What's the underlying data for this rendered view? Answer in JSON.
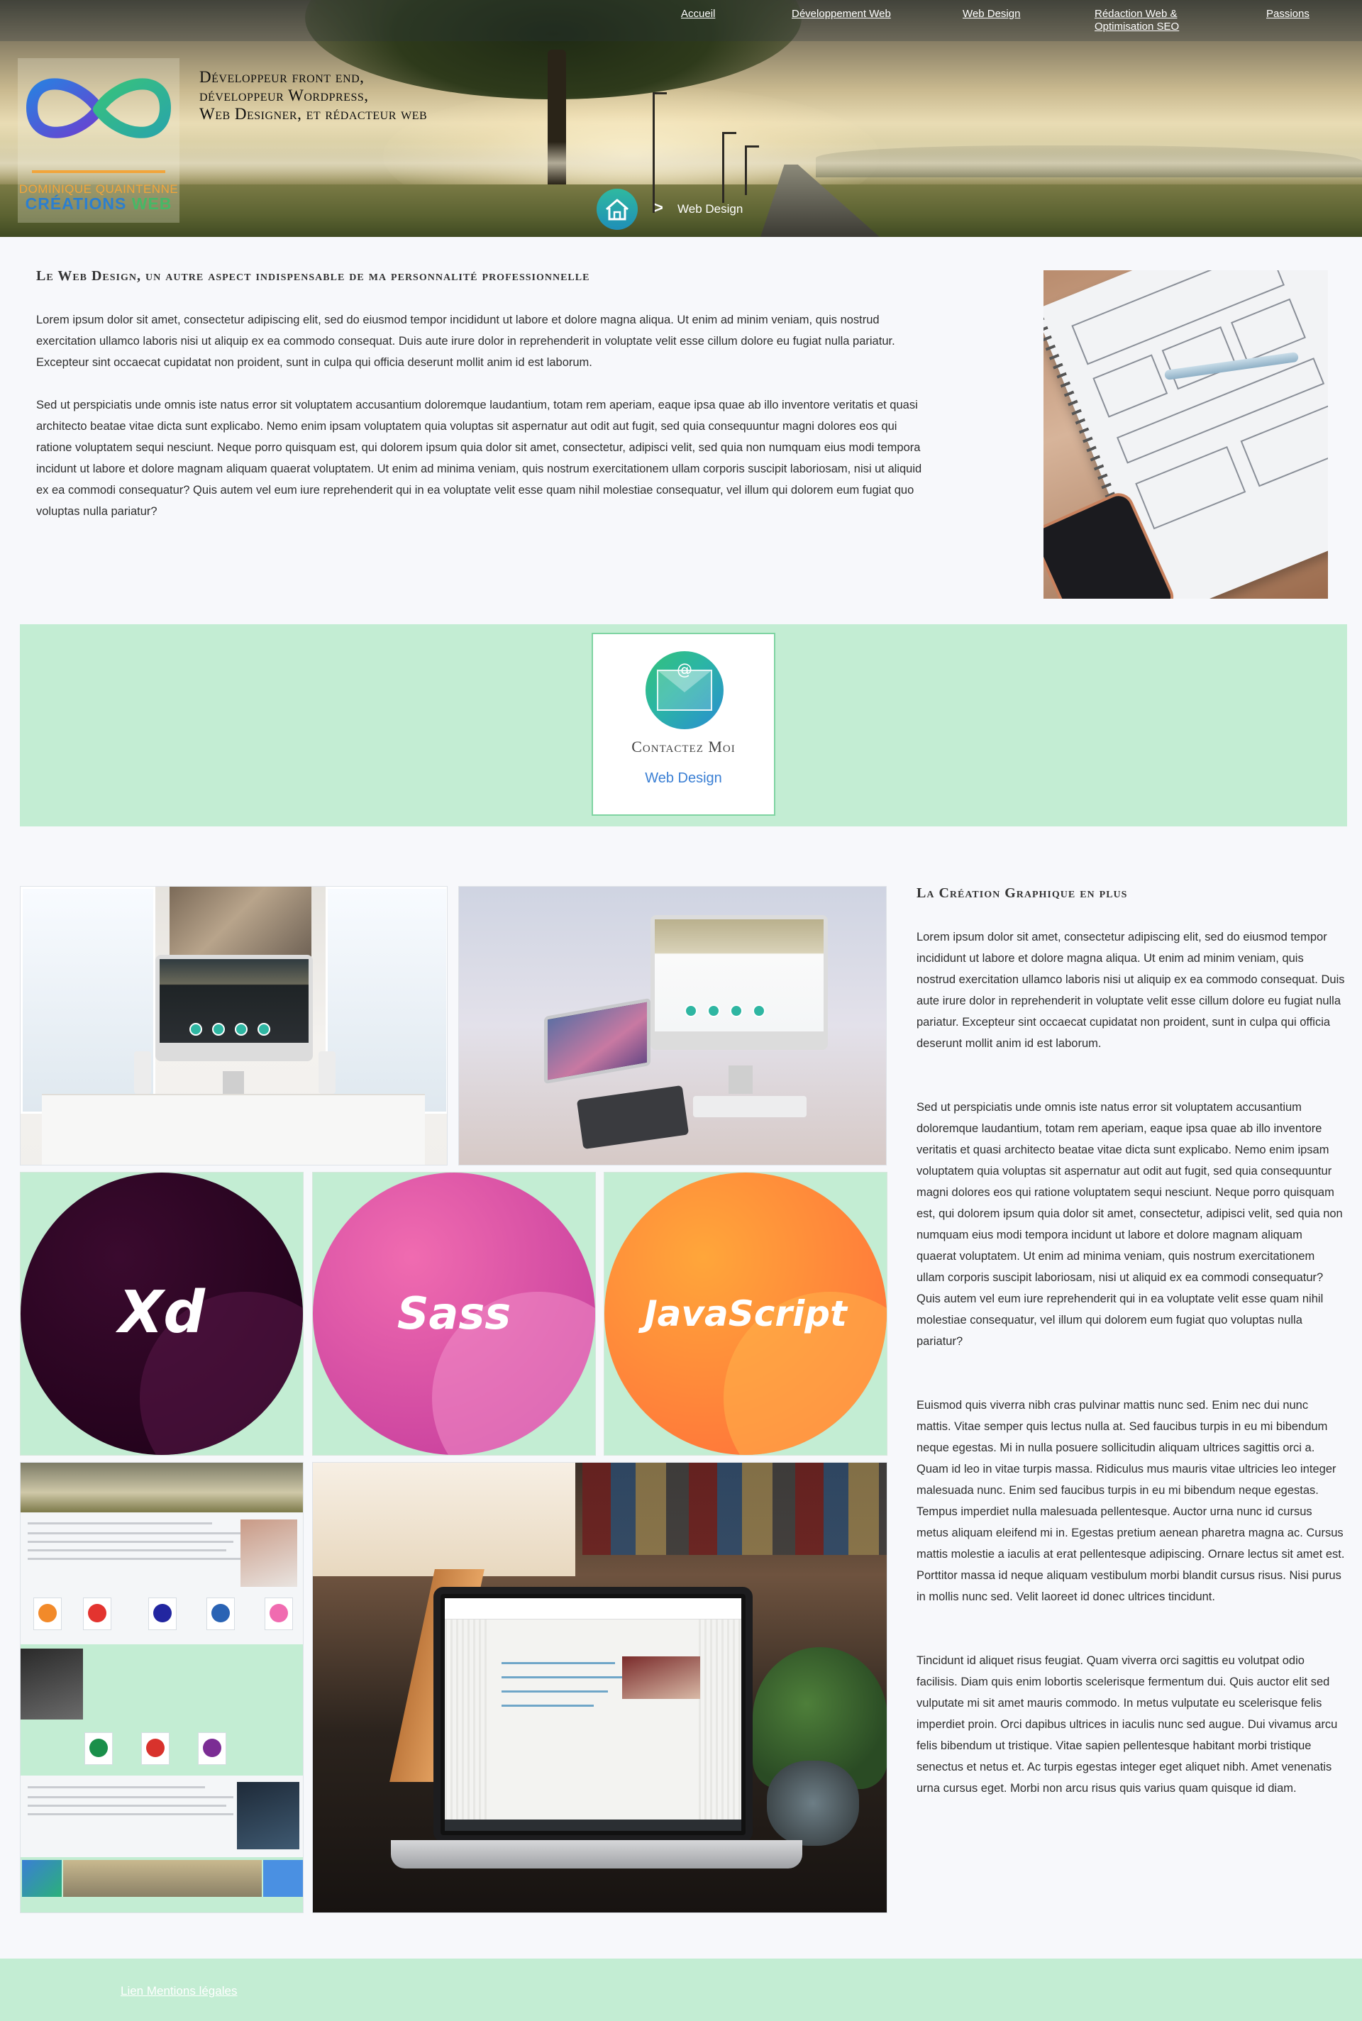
{
  "nav": {
    "items": [
      {
        "label": "Accueil"
      },
      {
        "label": "Développement Web"
      },
      {
        "label": "Web Design"
      },
      {
        "label": "Rédaction Web  &",
        "label2": "Optimisation SEO"
      },
      {
        "label": "Passions"
      }
    ]
  },
  "logo": {
    "name": "DOMINIQUE QUAINTENNE",
    "brand_part1": "CRÉATIONS ",
    "brand_part2": "WEB"
  },
  "tagline": {
    "lines": [
      "Développeur front end,",
      "développeur Wordpress,",
      "Web Designer, et rédacteur web"
    ]
  },
  "breadcrumb": {
    "home_icon": "home-icon",
    "separator": ">",
    "current": "Web Design"
  },
  "intro": {
    "title": "Le Web Design, un autre aspect indispensable de ma personnalité professionnelle",
    "paragraphs": [
      "Lorem ipsum dolor sit amet, consectetur adipiscing elit, sed do eiusmod tempor incididunt ut labore et dolore magna aliqua. Ut enim ad minim veniam, quis nostrud exercitation ullamco laboris nisi ut aliquip ex ea commodo consequat. Duis aute irure dolor in reprehenderit in voluptate velit esse cillum dolore eu fugiat nulla pariatur. Excepteur sint occaecat cupidatat non proident, sunt in culpa qui officia deserunt mollit anim id est laborum.",
      "Sed ut perspiciatis unde omnis iste natus error sit voluptatem accusantium doloremque laudantium, totam rem aperiam, eaque ipsa quae ab illo inventore veritatis et quasi architecto beatae vitae dicta sunt explicabo. Nemo enim ipsam voluptatem quia voluptas sit aspernatur aut odit aut fugit, sed quia consequuntur magni dolores eos qui ratione voluptatem sequi nesciunt. Neque porro quisquam est, qui dolorem ipsum quia dolor sit amet, consectetur, adipisci velit, sed quia non numquam eius modi tempora incidunt ut labore et dolore magnam aliquam quaerat voluptatem. Ut enim ad minima veniam, quis nostrum exercitationem ullam corporis suscipit laboriosam, nisi ut aliquid ex ea commodi consequatur? Quis autem vel eum iure reprehenderit qui in ea voluptate velit esse quam nihil molestiae consequatur, vel illum qui dolorem eum fugiat quo voluptas nulla pariatur?"
    ]
  },
  "contact": {
    "icon": "mail-icon",
    "at": "@",
    "title": "Contactez Moi",
    "subtitle": "Web Design"
  },
  "logos": [
    {
      "text": "Xd",
      "colors": [
        "#3a0a2e",
        "#1c0016"
      ],
      "fold": "#5a1848"
    },
    {
      "text": "Sass",
      "colors": [
        "#f06bb0",
        "#c0389a"
      ],
      "fold": "#f08ec8"
    },
    {
      "text": "JavaScript",
      "colors": [
        "#ffa63a",
        "#ff6a3a"
      ],
      "fold": "#ffb34a"
    }
  ],
  "creation": {
    "title": "La Création Graphique en plus",
    "paragraphs": [
      "Lorem ipsum dolor sit amet, consectetur adipiscing elit, sed do eiusmod tempor incididunt ut labore et dolore magna aliqua. Ut enim ad minim veniam, quis nostrud exercitation ullamco laboris nisi ut aliquip ex ea commodo consequat. Duis aute irure dolor in reprehenderit in voluptate velit esse cillum dolore eu fugiat nulla pariatur. Excepteur sint occaecat cupidatat non proident, sunt in culpa qui officia deserunt mollit anim id est laborum.",
      "Sed ut perspiciatis unde omnis iste natus error sit voluptatem accusantium doloremque laudantium, totam rem aperiam, eaque ipsa quae ab illo inventore veritatis et quasi architecto beatae vitae dicta sunt explicabo. Nemo enim ipsam voluptatem quia voluptas sit aspernatur aut odit aut fugit, sed quia consequuntur magni dolores eos qui ratione voluptatem sequi nesciunt. Neque porro quisquam est, qui dolorem ipsum quia dolor sit amet, consectetur, adipisci velit, sed quia non numquam eius modi tempora incidunt ut labore et dolore magnam aliquam quaerat voluptatem. Ut enim ad minima veniam, quis nostrum exercitationem ullam corporis suscipit laboriosam, nisi ut aliquid ex ea commodi consequatur? Quis autem vel eum iure reprehenderit qui in ea voluptate velit esse quam nihil molestiae consequatur, vel illum qui dolorem eum fugiat quo voluptas nulla pariatur?",
      "Euismod quis viverra nibh cras pulvinar mattis nunc sed. Enim nec dui nunc mattis. Vitae semper quis lectus nulla at. Sed faucibus turpis in eu mi bibendum neque egestas. Mi in nulla posuere sollicitudin aliquam ultrices sagittis orci a. Quam id leo in vitae turpis massa. Ridiculus mus mauris vitae ultricies leo integer malesuada nunc. Enim sed faucibus turpis in eu mi bibendum neque egestas. Tempus imperdiet nulla malesuada pellentesque. Auctor urna nunc id cursus metus aliquam eleifend mi in. Egestas pretium aenean pharetra magna ac. Cursus mattis molestie a iaculis at erat pellentesque adipiscing. Ornare lectus sit amet est. Porttitor massa id neque aliquam vestibulum morbi blandit cursus risus. Nisi purus in mollis nunc sed. Velit laoreet id donec ultrices tincidunt.",
      "Tincidunt id aliquet risus feugiat. Quam viverra orci sagittis eu volutpat odio facilisis. Diam quis enim lobortis scelerisque fermentum dui. Quis auctor elit sed vulputate mi sit amet mauris commodo. In metus vulputate eu scelerisque felis imperdiet proin. Orci dapibus ultrices in iaculis nunc sed augue. Dui vivamus arcu felis bibendum ut tristique. Vitae sapien pellentesque habitant morbi tristique senectus et netus et. Ac turpis egestas integer eget aliquet nibh. Amet venenatis urna cursus eget. Morbi non arcu risus quis varius quam quisque id diam."
    ]
  },
  "footer": {
    "link": "Lien Mentions légales"
  },
  "colors": {
    "mint": "#c3edd3",
    "accent_blue": "#3a7fd4",
    "logo_orange": "#f2a53a",
    "logo_green": "#46b866"
  }
}
